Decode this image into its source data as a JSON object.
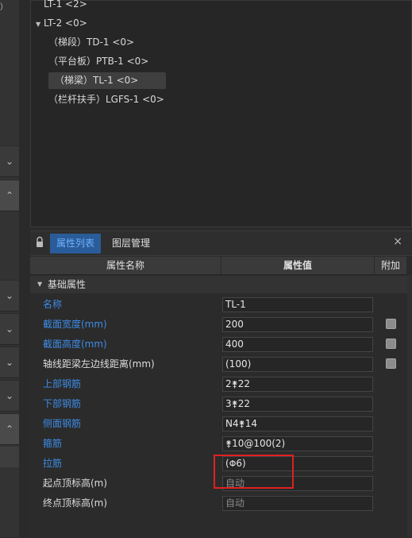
{
  "left_strip": {
    "top_fragment": "）"
  },
  "tree": {
    "items": [
      {
        "label": "LT-1 <2>"
      },
      {
        "label": "LT-2 <0>"
      },
      {
        "label": "（梯段）TD-1 <0>"
      },
      {
        "label": "（平台板）PTB-1 <0>"
      },
      {
        "label": "（梯梁）TL-1 <0>"
      },
      {
        "label": "（栏杆扶手）LGFS-1 <0>"
      }
    ]
  },
  "panel": {
    "tabs": [
      {
        "label": "属性列表"
      },
      {
        "label": "图层管理"
      }
    ],
    "close_glyph": "×",
    "columns": {
      "name": "属性名称",
      "value": "属性值",
      "extra": "附加"
    },
    "section": {
      "label": "基础属性"
    },
    "rows": [
      {
        "name": "名称",
        "value": "TL-1"
      },
      {
        "name": "截面宽度(mm)",
        "value": "200"
      },
      {
        "name": "截面高度(mm)",
        "value": "400"
      },
      {
        "name": "轴线距梁左边线距离(mm)",
        "value": "(100)"
      },
      {
        "name": "上部钢筋",
        "value": "2",
        "rebar_symbol": "⚵",
        "value_suffix": "22"
      },
      {
        "name": "下部钢筋",
        "value": "3",
        "rebar_symbol": "⚵",
        "value_suffix": "22"
      },
      {
        "name": "侧面钢筋",
        "value": "N4",
        "rebar_symbol": "⚵",
        "value_suffix": "14"
      },
      {
        "name": "箍筋",
        "value": "",
        "rebar_symbol": "⚵",
        "value_suffix": "10@100(2)"
      },
      {
        "name": "拉筋",
        "value": "(",
        "rebar_symbol": "Φ",
        "value_suffix": "6)"
      },
      {
        "name": "起点顶标高(m)",
        "value": "自动"
      },
      {
        "name": "终点顶标高(m)",
        "value": "自动"
      }
    ]
  },
  "colors": {
    "accent": "#3c8ce8",
    "tab_active_bg": "#2a5c99",
    "highlight": "#e02020"
  }
}
